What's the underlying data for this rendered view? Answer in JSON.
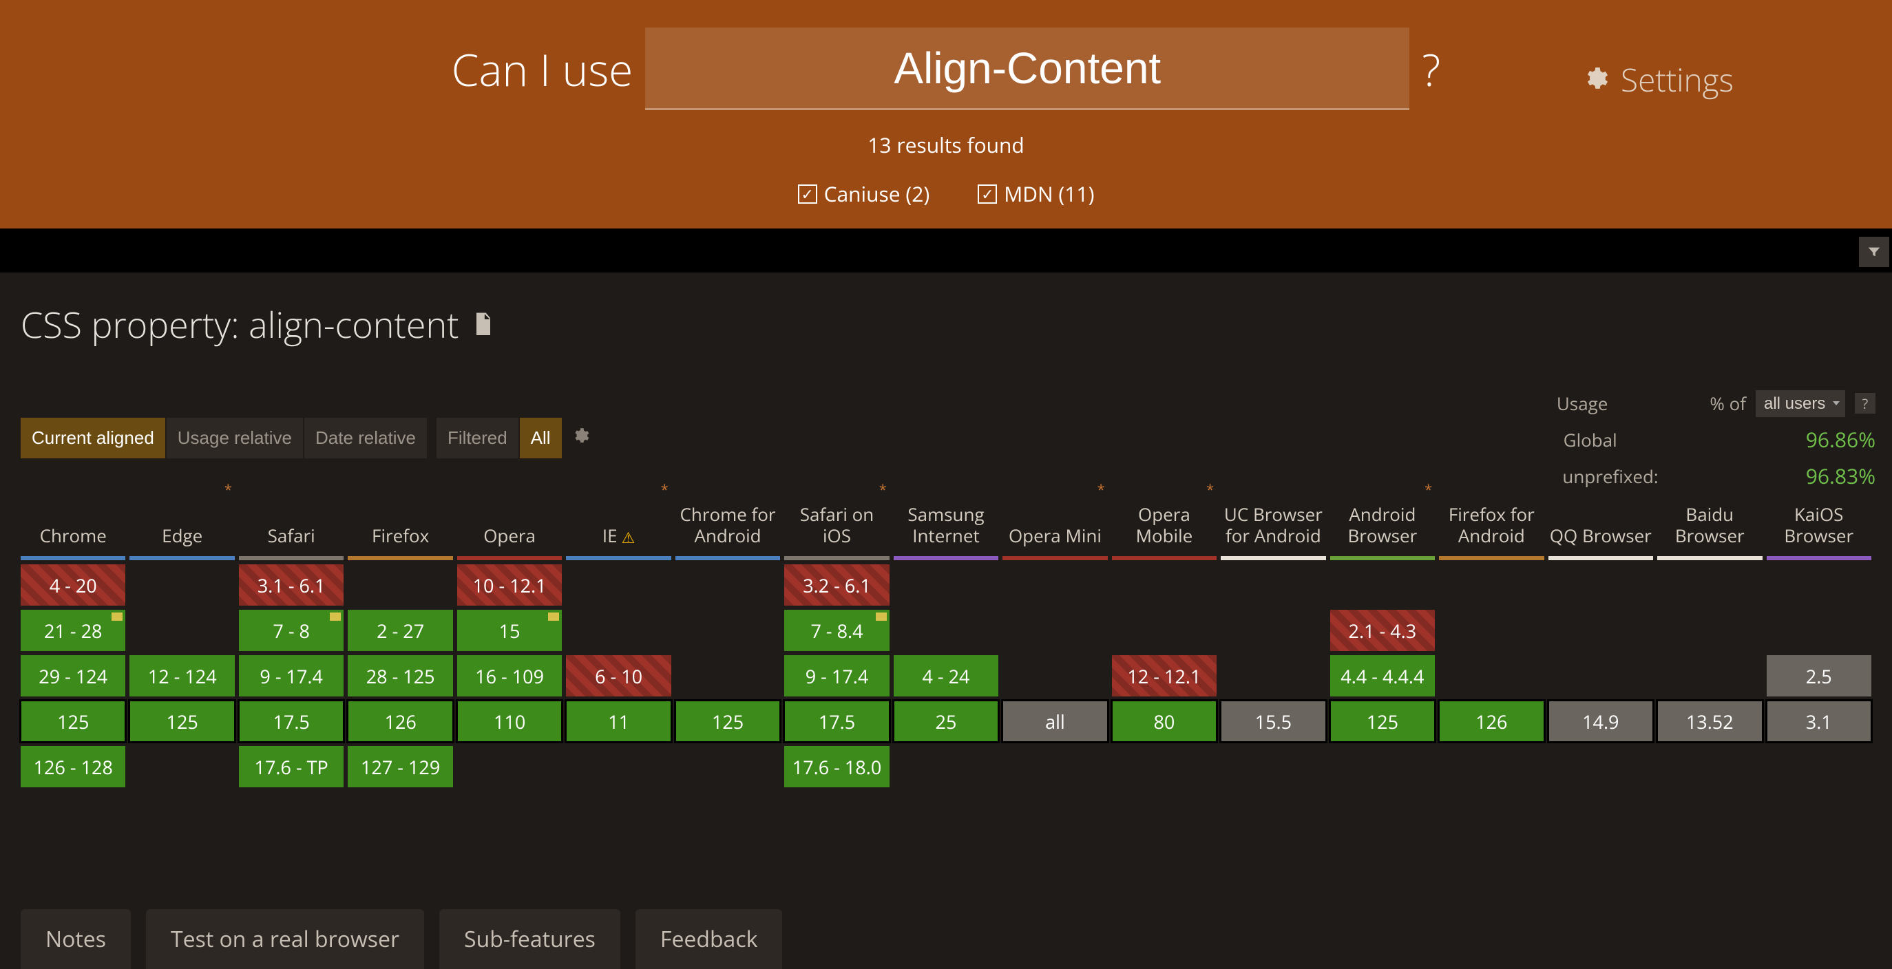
{
  "header": {
    "label": "Can I use",
    "search_value": "Align-Content",
    "question": "?",
    "settings": "Settings",
    "results": "13 results found",
    "sources": {
      "caniuse": "Caniuse (2)",
      "mdn": "MDN (11)"
    }
  },
  "feature": {
    "title": "CSS property: align-content"
  },
  "usage": {
    "label": "Usage",
    "pct_of": "% of",
    "selected": "all users",
    "help": "?",
    "global_label": "Global",
    "global_pct": "96.86%",
    "unprefixed_label": "unprefixed:",
    "unprefixed_pct": "96.83%"
  },
  "controls": {
    "align_current": "Current aligned",
    "usage_relative": "Usage relative",
    "date_relative": "Date relative",
    "filtered": "Filtered",
    "all": "All"
  },
  "browsers": [
    {
      "name": "Chrome",
      "underline": "#4b7fbf",
      "star": false,
      "warn": false
    },
    {
      "name": "Edge",
      "underline": "#4b7fbf",
      "star": true,
      "warn": false
    },
    {
      "name": "Safari",
      "underline": "#7d766c",
      "star": false,
      "warn": false
    },
    {
      "name": "Firefox",
      "underline": "#b37a2f",
      "star": false,
      "warn": false
    },
    {
      "name": "Opera",
      "underline": "#a03329",
      "star": false,
      "warn": false
    },
    {
      "name": "IE",
      "underline": "#4b7fbf",
      "star": true,
      "warn": true
    },
    {
      "name": "Chrome for Android",
      "underline": "#4b7fbf",
      "star": false,
      "warn": false
    },
    {
      "name": "Safari on iOS",
      "underline": "#7d766c",
      "star": true,
      "warn": false
    },
    {
      "name": "Samsung Internet",
      "underline": "#8c5bbf",
      "star": false,
      "warn": false
    },
    {
      "name": "Opera Mini",
      "underline": "#a03329",
      "star": true,
      "warn": false
    },
    {
      "name": "Opera Mobile",
      "underline": "#a03329",
      "star": true,
      "warn": false
    },
    {
      "name": "UC Browser for Android",
      "underline": "#e8e2d8",
      "star": false,
      "warn": false
    },
    {
      "name": "Android Browser",
      "underline": "#6aa038",
      "star": true,
      "warn": false
    },
    {
      "name": "Firefox for Android",
      "underline": "#b37a2f",
      "star": false,
      "warn": false
    },
    {
      "name": "QQ Browser",
      "underline": "#e8e2d8",
      "star": false,
      "warn": false
    },
    {
      "name": "Baidu Browser",
      "underline": "#e8e2d8",
      "star": false,
      "warn": false
    },
    {
      "name": "KaiOS Browser",
      "underline": "#8c5bbf",
      "star": false,
      "warn": false
    }
  ],
  "grid": [
    [
      {
        "t": "4 - 20",
        "c": "red"
      },
      null,
      {
        "t": "3.1 - 6.1",
        "c": "red"
      },
      null,
      {
        "t": "10 - 12.1",
        "c": "red"
      },
      null,
      null,
      {
        "t": "3.2 - 6.1",
        "c": "red"
      },
      null,
      null,
      null,
      null,
      null,
      null,
      null,
      null,
      null
    ],
    [
      {
        "t": "21 - 28",
        "c": "green",
        "dot": true
      },
      null,
      {
        "t": "7 - 8",
        "c": "green",
        "dot": true
      },
      {
        "t": "2 - 27",
        "c": "green"
      },
      {
        "t": "15",
        "c": "green",
        "dot": true
      },
      null,
      null,
      {
        "t": "7 - 8.4",
        "c": "green",
        "dot": true
      },
      null,
      null,
      null,
      null,
      {
        "t": "2.1 - 4.3",
        "c": "red"
      },
      null,
      null,
      null,
      null
    ],
    [
      {
        "t": "29 - 124",
        "c": "green"
      },
      {
        "t": "12 - 124",
        "c": "green"
      },
      {
        "t": "9 - 17.4",
        "c": "green"
      },
      {
        "t": "28 - 125",
        "c": "green"
      },
      {
        "t": "16 - 109",
        "c": "green"
      },
      {
        "t": "6 - 10",
        "c": "red"
      },
      null,
      {
        "t": "9 - 17.4",
        "c": "green"
      },
      {
        "t": "4 - 24",
        "c": "green"
      },
      null,
      {
        "t": "12 - 12.1",
        "c": "red"
      },
      null,
      {
        "t": "4.4 - 4.4.4",
        "c": "green"
      },
      null,
      null,
      null,
      {
        "t": "2.5",
        "c": "gray"
      }
    ],
    [
      {
        "t": "125",
        "c": "green",
        "cur": true
      },
      {
        "t": "125",
        "c": "green",
        "cur": true
      },
      {
        "t": "17.5",
        "c": "green",
        "cur": true
      },
      {
        "t": "126",
        "c": "green",
        "cur": true
      },
      {
        "t": "110",
        "c": "green",
        "cur": true
      },
      {
        "t": "11",
        "c": "green",
        "cur": true
      },
      {
        "t": "125",
        "c": "green",
        "cur": true
      },
      {
        "t": "17.5",
        "c": "green",
        "cur": true
      },
      {
        "t": "25",
        "c": "green",
        "cur": true
      },
      {
        "t": "all",
        "c": "gray",
        "cur": true
      },
      {
        "t": "80",
        "c": "green",
        "cur": true
      },
      {
        "t": "15.5",
        "c": "gray",
        "cur": true
      },
      {
        "t": "125",
        "c": "green",
        "cur": true
      },
      {
        "t": "126",
        "c": "green",
        "cur": true
      },
      {
        "t": "14.9",
        "c": "gray",
        "cur": true
      },
      {
        "t": "13.52",
        "c": "gray",
        "cur": true
      },
      {
        "t": "3.1",
        "c": "gray",
        "cur": true
      }
    ],
    [
      {
        "t": "126 - 128",
        "c": "green"
      },
      null,
      {
        "t": "17.6 - TP",
        "c": "green"
      },
      {
        "t": "127 - 129",
        "c": "green"
      },
      null,
      null,
      null,
      {
        "t": "17.6 - 18.0",
        "c": "green"
      },
      null,
      null,
      null,
      null,
      null,
      null,
      null,
      null,
      null
    ]
  ],
  "tabs": {
    "notes": "Notes",
    "test": "Test on a real browser",
    "sub": "Sub-features",
    "feedback": "Feedback"
  }
}
